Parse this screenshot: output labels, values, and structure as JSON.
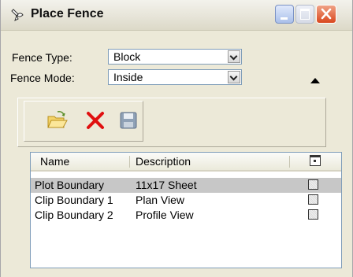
{
  "window": {
    "title": "Place Fence"
  },
  "fields": {
    "fence_type": {
      "label": "Fence Type:",
      "value": "Block"
    },
    "fence_mode": {
      "label": "Fence Mode:",
      "value": "Inside"
    }
  },
  "toolbar": {
    "icons": [
      "open-folder-icon",
      "delete-x-icon",
      "save-disk-icon"
    ]
  },
  "list": {
    "columns": [
      "Name",
      "Description"
    ],
    "rows": [
      {
        "name": "Plot Boundary",
        "description": "11x17 Sheet",
        "selected": true
      },
      {
        "name": "Clip Boundary 1",
        "description": "Plan View",
        "selected": false
      },
      {
        "name": "Clip Boundary 2",
        "description": "Profile View",
        "selected": false
      }
    ]
  },
  "colors": {
    "title_bar": "#e9e7dc",
    "close_button": "#d9471e",
    "dialog_background": "#ece9d8",
    "selected_row": "#c7c7c7"
  }
}
